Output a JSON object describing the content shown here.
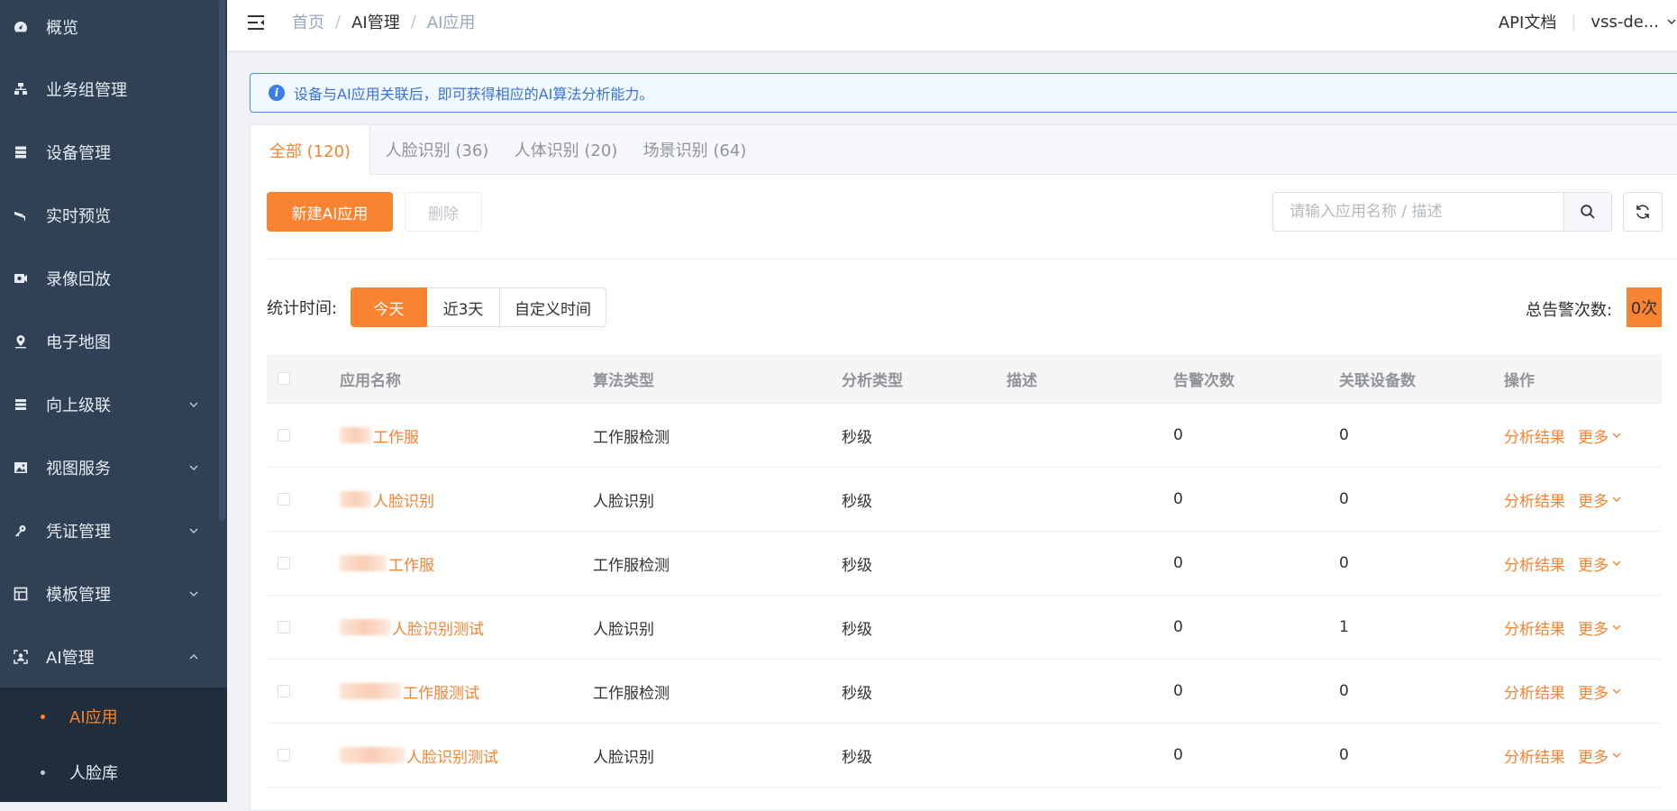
{
  "sidebar": {
    "items": [
      {
        "label": "概览",
        "icon": "dashboard-icon"
      },
      {
        "label": "业务组管理",
        "icon": "org-tree-icon"
      },
      {
        "label": "设备管理",
        "icon": "server-icon"
      },
      {
        "label": "实时预览",
        "icon": "camera-icon"
      },
      {
        "label": "录像回放",
        "icon": "video-icon"
      },
      {
        "label": "电子地图",
        "icon": "map-pin-icon"
      },
      {
        "label": "向上级联",
        "icon": "cascade-icon"
      },
      {
        "label": "视图服务",
        "icon": "image-icon"
      },
      {
        "label": "凭证管理",
        "icon": "key-icon"
      },
      {
        "label": "模板管理",
        "icon": "template-icon"
      },
      {
        "label": "AI管理",
        "icon": "ai-scan-icon"
      }
    ],
    "sub_items": [
      {
        "label": "AI应用"
      },
      {
        "label": "人脸库"
      }
    ]
  },
  "header": {
    "breadcrumb": [
      "首页",
      "AI管理",
      "AI应用"
    ],
    "separator": "/",
    "api_doc": "API文档",
    "divider": "|",
    "user": "vss-de..."
  },
  "alert": {
    "text": "设备与AI应用关联后，即可获得相应的AI算法分析能力。"
  },
  "tabs": [
    {
      "label": "全部 (120)"
    },
    {
      "label": "人脸识别 (36)"
    },
    {
      "label": "人体识别 (20)"
    },
    {
      "label": "场景识别 (64)"
    }
  ],
  "toolbar": {
    "new_label": "新建AI应用",
    "delete_label": "删除",
    "search_placeholder": "请输入应用名称 / 描述"
  },
  "stats": {
    "label": "统计时间:",
    "options": [
      "今天",
      "近3天",
      "自定义时间"
    ],
    "total_label": "总告警次数:",
    "total_value": "0次"
  },
  "table": {
    "columns": [
      "应用名称",
      "算法类型",
      "分析类型",
      "描述",
      "告警次数",
      "关联设备数",
      "操作"
    ],
    "rows": [
      {
        "name": "工作服",
        "algo": "工作服检测",
        "analysis": "秒级",
        "desc": "",
        "alarms": "0",
        "devices": "0"
      },
      {
        "name": "人脸识别",
        "algo": "人脸识别",
        "analysis": "秒级",
        "desc": "",
        "alarms": "0",
        "devices": "0"
      },
      {
        "name": "工作服",
        "algo": "工作服检测",
        "analysis": "秒级",
        "desc": "",
        "alarms": "0",
        "devices": "0"
      },
      {
        "name": "人脸识别测试",
        "algo": "人脸识别",
        "analysis": "秒级",
        "desc": "",
        "alarms": "0",
        "devices": "1"
      },
      {
        "name": "工作服测试",
        "algo": "工作服检测",
        "analysis": "秒级",
        "desc": "",
        "alarms": "0",
        "devices": "0"
      },
      {
        "name": "人脸识别测试",
        "algo": "人脸识别",
        "analysis": "秒级",
        "desc": "",
        "alarms": "0",
        "devices": "0"
      }
    ],
    "action_result": "分析结果",
    "action_more": "更多"
  },
  "colors": {
    "sidebar_bg": "#304156",
    "submenu_bg": "#1f2d3d",
    "accent": "#f98331",
    "info_blue": "#3a7fe6"
  }
}
